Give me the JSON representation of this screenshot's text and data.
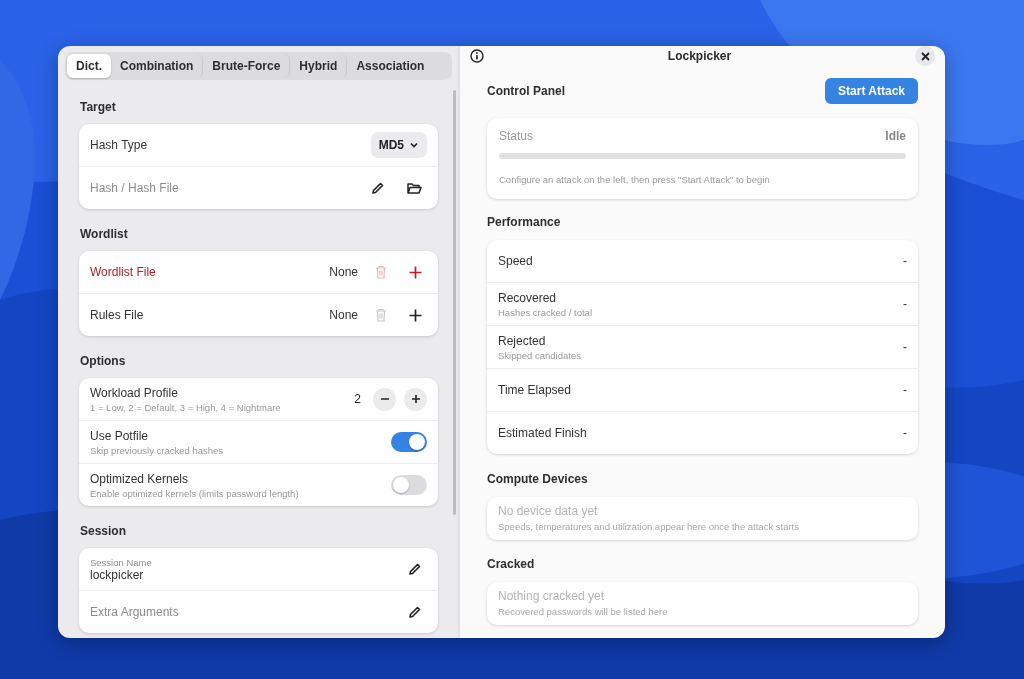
{
  "tabs": [
    {
      "label": "Dict.",
      "selected": true
    },
    {
      "label": "Combination",
      "selected": false
    },
    {
      "label": "Brute-Force",
      "selected": false
    },
    {
      "label": "Hybrid",
      "selected": false
    },
    {
      "label": "Association",
      "selected": false
    }
  ],
  "sections": [
    {
      "heading": "Target",
      "rows": [
        {
          "kind": "select",
          "label": "Hash Type",
          "value": "MD5"
        },
        {
          "kind": "hashfile",
          "placeholder": "Hash / Hash File"
        }
      ]
    },
    {
      "heading": "Wordlist",
      "rows": [
        {
          "kind": "filepick",
          "label": "Wordlist File",
          "value": "None",
          "error": true
        },
        {
          "kind": "filepick",
          "label": "Rules File",
          "value": "None",
          "error": false
        }
      ]
    },
    {
      "heading": "Options",
      "rows": [
        {
          "kind": "spin",
          "label": "Workload Profile",
          "sub": "1 = Low, 2 = Default, 3 = High, 4 = Nightmare",
          "value": "2"
        },
        {
          "kind": "switch",
          "label": "Use Potfile",
          "sub": "Skip previously cracked hashes",
          "on": true
        },
        {
          "kind": "switch",
          "label": "Optimized Kernels",
          "sub": "Enable optimized kernels (limits password length)",
          "on": false
        }
      ]
    },
    {
      "heading": "Session",
      "rows": [
        {
          "kind": "entry",
          "caption": "Session Name",
          "value": "lockpicker"
        },
        {
          "kind": "entry",
          "placeholder": "Extra Arguments"
        }
      ]
    }
  ],
  "window": {
    "title": "Lockpicker"
  },
  "control_panel": {
    "heading": "Control Panel",
    "button": "Start Attack",
    "status": {
      "label": "Status",
      "value": "Idle",
      "level": 0,
      "hint": "Configure an attack on the left, then press \"Start Attack\" to begin"
    }
  },
  "performance": {
    "heading": "Performance",
    "rows": [
      {
        "label": "Speed",
        "value": "-"
      },
      {
        "label": "Recovered",
        "sub": "Hashes cracked / total",
        "value": "-"
      },
      {
        "label": "Rejected",
        "sub": "Skipped candidates",
        "value": "-"
      },
      {
        "label": "Time Elapsed",
        "value": "-"
      },
      {
        "label": "Estimated Finish",
        "value": "-"
      }
    ]
  },
  "compute_devices": {
    "heading": "Compute Devices",
    "title": "No device data yet",
    "hint": "Speeds, temperatures and utilization appear here once the attack starts"
  },
  "cracked": {
    "heading": "Cracked",
    "title": "Nothing cracked yet",
    "hint": "Recovered passwords will be listed here"
  }
}
